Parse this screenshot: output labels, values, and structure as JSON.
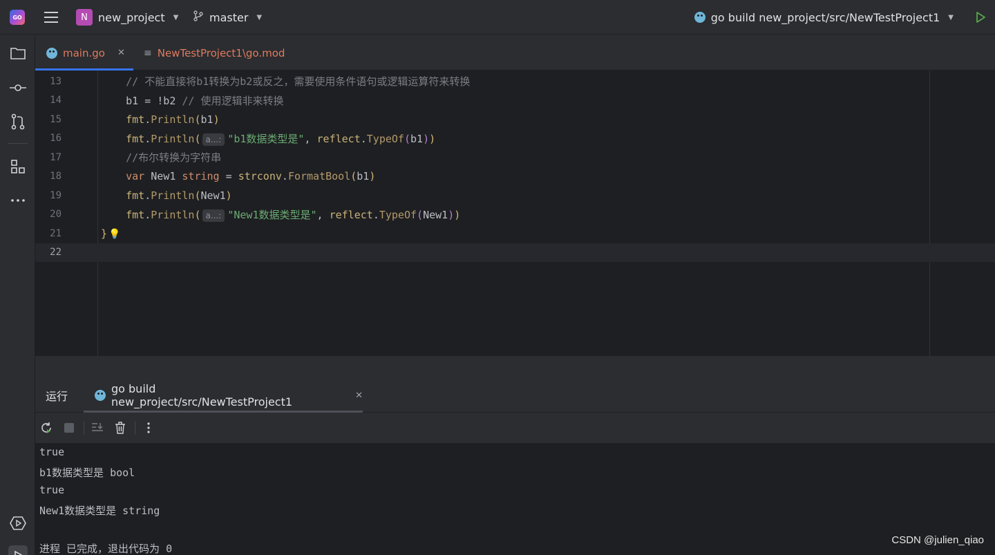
{
  "titlebar": {
    "project_initial": "N",
    "project_name": "new_project",
    "branch": "master",
    "run_config": "go build new_project/src/NewTestProject1"
  },
  "editor_tabs": [
    {
      "label": "main.go",
      "active": true
    },
    {
      "label": "NewTestProject1\\go.mod",
      "active": false
    }
  ],
  "code": {
    "current_line": 22,
    "lines": [
      {
        "n": "13",
        "parts": [
          [
            "c-comment",
            "    // 不能直接将b1转换为b2或反之，需要使用条件语句或逻辑运算符来转换"
          ]
        ]
      },
      {
        "n": "14",
        "parts": [
          [
            "",
            "    b1 = !b2 "
          ],
          [
            "c-comment",
            "// 使用逻辑非来转换"
          ]
        ]
      },
      {
        "n": "15",
        "parts": [
          [
            "c-pkg",
            "    fmt"
          ],
          [
            "",
            "."
          ],
          [
            "c-call",
            "Println"
          ],
          [
            "c-par",
            "("
          ],
          [
            "",
            "b1"
          ],
          [
            "c-par",
            ")"
          ]
        ]
      },
      {
        "n": "16",
        "parts": [
          [
            "c-pkg",
            "    fmt"
          ],
          [
            "",
            "."
          ],
          [
            "c-call",
            "Println"
          ],
          [
            "c-par",
            "("
          ],
          [
            "hint",
            "a...:"
          ],
          [
            "c-str",
            "\"b1数据类型是\""
          ],
          [
            "",
            ", "
          ],
          [
            "c-pkg",
            "reflect"
          ],
          [
            "",
            "."
          ],
          [
            "c-call",
            "TypeOf"
          ],
          [
            "c-par2",
            "("
          ],
          [
            "",
            "b1"
          ],
          [
            "c-par2",
            ")"
          ],
          [
            "c-par",
            ")"
          ]
        ]
      },
      {
        "n": "17",
        "parts": [
          [
            "c-comment",
            "    //布尔转换为字符串"
          ]
        ]
      },
      {
        "n": "18",
        "parts": [
          [
            "c-kw",
            "    var "
          ],
          [
            "",
            "New1 "
          ],
          [
            "c-kw",
            "string"
          ],
          [
            "",
            " = "
          ],
          [
            "c-pkg",
            "strconv"
          ],
          [
            "",
            "."
          ],
          [
            "c-call",
            "FormatBool"
          ],
          [
            "c-par",
            "("
          ],
          [
            "",
            "b1"
          ],
          [
            "c-par",
            ")"
          ]
        ]
      },
      {
        "n": "19",
        "parts": [
          [
            "c-pkg",
            "    fmt"
          ],
          [
            "",
            "."
          ],
          [
            "c-call",
            "Println"
          ],
          [
            "c-par",
            "("
          ],
          [
            "",
            "New1"
          ],
          [
            "c-par",
            ")"
          ]
        ]
      },
      {
        "n": "20",
        "parts": [
          [
            "c-pkg",
            "    fmt"
          ],
          [
            "",
            "."
          ],
          [
            "c-call",
            "Println"
          ],
          [
            "c-par",
            "("
          ],
          [
            "hint",
            "a...:"
          ],
          [
            "c-str",
            "\"New1数据类型是\""
          ],
          [
            "",
            ", "
          ],
          [
            "c-pkg",
            "reflect"
          ],
          [
            "",
            "."
          ],
          [
            "c-call",
            "TypeOf"
          ],
          [
            "c-par2",
            "("
          ],
          [
            "",
            "New1"
          ],
          [
            "c-par2",
            ")"
          ],
          [
            "c-par",
            ")"
          ]
        ]
      },
      {
        "n": "21",
        "parts": [
          [
            "brace",
            "}"
          ],
          [
            "bulb",
            "💡"
          ]
        ]
      },
      {
        "n": "22",
        "parts": []
      }
    ]
  },
  "run_panel": {
    "title": "运行",
    "tab_label": "go build new_project/src/NewTestProject1",
    "output": [
      "true",
      "b1数据类型是 bool",
      "true",
      "New1数据类型是 string",
      "",
      "进程 已完成，退出代码为 0"
    ]
  },
  "watermark": "CSDN @julien_qiao",
  "colors": {
    "accent": "#3574f0",
    "run_green": "#57a64a",
    "tab_file": "#e07a5f"
  }
}
